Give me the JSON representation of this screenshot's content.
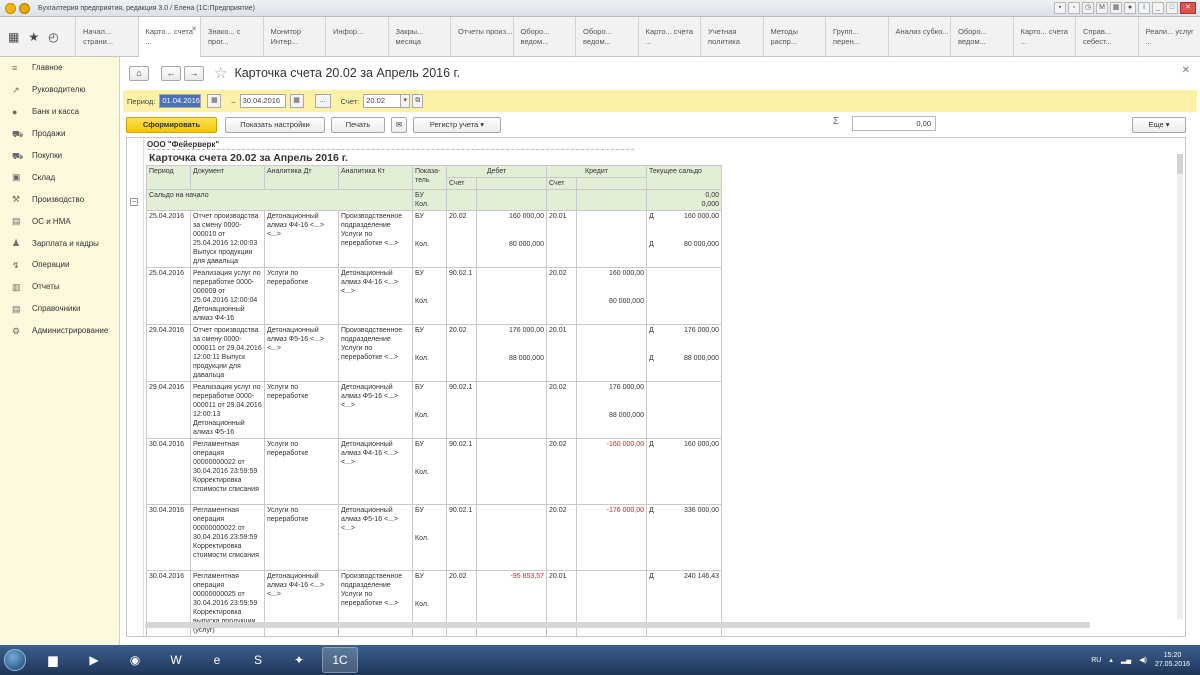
{
  "window": {
    "title": "Бухгалтерия предприятия, редакция 3.0 / Елена  (1С:Предприятие)"
  },
  "tabs": [
    {
      "label": "Начал... страни..."
    },
    {
      "label": "Карто... счета ..."
    },
    {
      "label": "Знако... с прог..."
    },
    {
      "label": "Монитор Интер..."
    },
    {
      "label": "Инфор..."
    },
    {
      "label": "Закры... месяца"
    },
    {
      "label": "Отчеты произ..."
    },
    {
      "label": "Оборо... ведом..."
    },
    {
      "label": "Оборо... ведом..."
    },
    {
      "label": "Карто... счета ..."
    },
    {
      "label": "Учетная политика"
    },
    {
      "label": "Методы распр..."
    },
    {
      "label": "Групп... перен..."
    },
    {
      "label": "Анализ субко..."
    },
    {
      "label": "Оборо... ведом..."
    },
    {
      "label": "Карто... счета ..."
    },
    {
      "label": "Справ... себест..."
    },
    {
      "label": "Реали... услуг ..."
    }
  ],
  "sidebar": {
    "items": [
      {
        "label": "Главное",
        "icon": "menu-lines-icon"
      },
      {
        "label": "Руководителю",
        "icon": "trend-icon"
      },
      {
        "label": "Банк и касса",
        "icon": "coins-icon"
      },
      {
        "label": "Продажи",
        "icon": "cart-icon"
      },
      {
        "label": "Покупки",
        "icon": "truck-icon"
      },
      {
        "label": "Склад",
        "icon": "box-icon"
      },
      {
        "label": "Производство",
        "icon": "factory-icon"
      },
      {
        "label": "ОС и НМА",
        "icon": "building-icon"
      },
      {
        "label": "Зарплата и кадры",
        "icon": "people-icon"
      },
      {
        "label": "Операции",
        "icon": "operations-icon"
      },
      {
        "label": "Отчеты",
        "icon": "chart-icon"
      },
      {
        "label": "Справочники",
        "icon": "book-icon"
      },
      {
        "label": "Администрирование",
        "icon": "gear-icon"
      }
    ]
  },
  "form": {
    "title": "Карточка счета 20.02 за Апрель 2016 г.",
    "period_label": "Период:",
    "date_from": "01.04.2016",
    "date_to": "30.04.2016",
    "dash": "–",
    "dots": "...",
    "account_label": "Счет:",
    "account": "20.02"
  },
  "actions": {
    "generate": "Сформировать",
    "show_settings": "Показать настройки",
    "print": "Печать",
    "register": "Регистр учета",
    "sum_value": "0,00",
    "more": "Еще"
  },
  "report": {
    "org": "ООО \"Фейерверк\"",
    "title": "Карточка счета 20.02 за Апрель 2016 г.",
    "headers": {
      "period": "Период",
      "document": "Документ",
      "an_dt": "Аналитика Дт",
      "an_kt": "Аналитика Кт",
      "indicator": "Показа-тель",
      "debit": "Дебет",
      "credit": "Кредит",
      "balance": "Текущее сальдо",
      "account": "Счет"
    },
    "saldo_start": {
      "label": "Сальдо на начало",
      "ind1": "БУ",
      "ind2": "Кол.",
      "val1": "0,00",
      "val2": "0,000"
    },
    "rows": [
      {
        "period": "25.04.2016",
        "document": "Отчет производства за смену 0000-000010 от 25.04.2016 12:00:03 Выпуск продукции для давальца",
        "an_dt": "Детонационный алмаз Ф4-16 <...><...>",
        "an_kt": "Производственное подразделение Услуги по переработке <...>",
        "ind1": "БУ",
        "ind2": "Кол.",
        "dt_acc": "20.02",
        "dt_sum": "160 000,00",
        "dt_qty": "80 000,000",
        "kt_acc": "20.01",
        "kt_sum": "",
        "kt_qty": "",
        "bal_dk1": "Д",
        "bal_sum": "160 000,00",
        "bal_dk2": "Д",
        "bal_qty": "80 000,000",
        "h": 57
      },
      {
        "period": "25.04.2016",
        "document": "Реализация услуг по переработке 0000-000009 от 25.04.2016 12:00:04 Детонационный алмаз Ф4-16",
        "an_dt": "Услуги по переработке",
        "an_kt": "Детонационный алмаз Ф4-16 <...><...>",
        "ind1": "БУ",
        "ind2": "Кол.",
        "dt_acc": "90.02.1",
        "dt_sum": "",
        "dt_qty": "",
        "kt_acc": "20.02",
        "kt_sum": "160 000,00",
        "kt_qty": "80 000,000",
        "bal_dk1": "",
        "bal_sum": "",
        "bal_dk2": "",
        "bal_qty": "",
        "h": 57
      },
      {
        "period": "29.04.2016",
        "document": "Отчет производства за смену 0000-000011 от 29.04.2016 12:00:11 Выпуск продукции для давальца",
        "an_dt": "Детонационный алмаз Ф5-16 <...><...>",
        "an_kt": "Производственное подразделение Услуги по переработке <...>",
        "ind1": "БУ",
        "ind2": "Кол.",
        "dt_acc": "20.02",
        "dt_sum": "176 000,00",
        "dt_qty": "88 000,000",
        "kt_acc": "20.01",
        "kt_sum": "",
        "kt_qty": "",
        "bal_dk1": "Д",
        "bal_sum": "176 000,00",
        "bal_dk2": "Д",
        "bal_qty": "88 000,000",
        "h": 57
      },
      {
        "period": "29.04.2016",
        "document": "Реализация услуг по переработке 0000-000011 от 29.04.2016 12:00:13 Детонационный алмаз Ф5-16",
        "an_dt": "Услуги по переработке",
        "an_kt": "Детонационный алмаз Ф5-16 <...><...>",
        "ind1": "БУ",
        "ind2": "Кол.",
        "dt_acc": "90.02.1",
        "dt_sum": "",
        "dt_qty": "",
        "kt_acc": "20.02",
        "kt_sum": "176 000,00",
        "kt_qty": "88 000,000",
        "bal_dk1": "",
        "bal_sum": "",
        "bal_dk2": "",
        "bal_qty": "",
        "h": 57
      },
      {
        "period": "30.04.2016",
        "document": "Регламентная операция 00000000022 от 30.04.2016 23:59:59 Корректировка стоимости списания",
        "an_dt": "Услуги по переработке",
        "an_kt": "Детонационный алмаз Ф4-16 <...><...>",
        "ind1": "БУ",
        "ind2": "Кол.",
        "dt_acc": "90.02.1",
        "dt_sum": "",
        "dt_qty": "",
        "kt_acc": "20.02",
        "kt_sum": "-160 000,00",
        "kt_qty": "",
        "bal_dk1": "Д",
        "bal_sum": "160 000,00",
        "bal_dk2": "",
        "bal_qty": "",
        "h": 66
      },
      {
        "period": "30.04.2016",
        "document": "Регламентная операция 00000000022 от 30.04.2016 23:59:59 Корректировка стоимости списания",
        "an_dt": "Услуги по переработке",
        "an_kt": "Детонационный алмаз Ф5-16 <...><...>",
        "ind1": "БУ",
        "ind2": "Кол.",
        "dt_acc": "90.02.1",
        "dt_sum": "",
        "dt_qty": "",
        "kt_acc": "20.02",
        "kt_sum": "-176 000,00",
        "kt_qty": "",
        "bal_dk1": "Д",
        "bal_sum": "336 000,00",
        "bal_dk2": "",
        "bal_qty": "",
        "h": 66
      },
      {
        "period": "30.04.2016",
        "document": "Регламентная операция 00000000025 от 30.04.2016 23:59:59 Корректировка выпуска продукции (услуг)",
        "an_dt": "Детонационный алмаз Ф4-16 <...><...>",
        "an_kt": "Производственное подразделение Услуги по переработке <...>",
        "ind1": "БУ",
        "ind2": "Кол.",
        "dt_acc": "20.02",
        "dt_sum": "-95 853,57",
        "dt_qty": "",
        "kt_acc": "20.01",
        "kt_sum": "",
        "kt_qty": "",
        "bal_dk1": "Д",
        "bal_sum": "240 146,43",
        "bal_dk2": "",
        "bal_qty": "",
        "h": 62
      }
    ]
  },
  "taskbar": {
    "lang": "RU",
    "time": "15:20",
    "date": "27.05.2016"
  }
}
